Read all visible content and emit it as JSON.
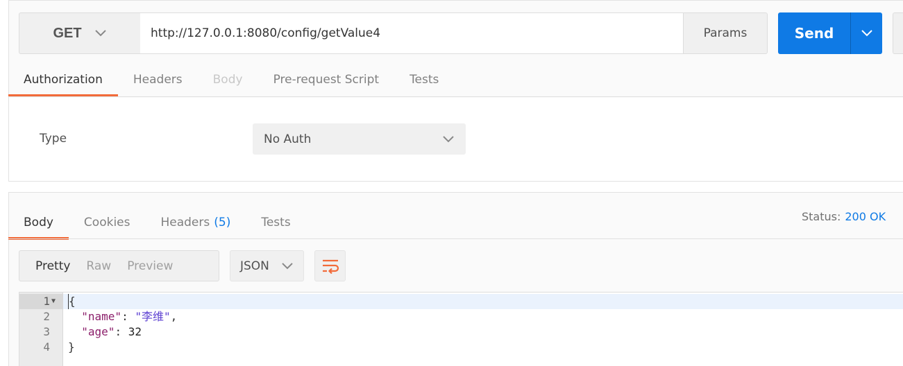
{
  "request": {
    "method": "GET",
    "url": "http://127.0.0.1:8080/config/getValue4",
    "params_label": "Params",
    "send_label": "Send",
    "tabs": [
      {
        "label": "Authorization",
        "state": "active"
      },
      {
        "label": "Headers",
        "state": "normal"
      },
      {
        "label": "Body",
        "state": "disabled"
      },
      {
        "label": "Pre-request Script",
        "state": "normal"
      },
      {
        "label": "Tests",
        "state": "normal"
      }
    ],
    "auth": {
      "type_label": "Type",
      "type_value": "No Auth"
    }
  },
  "response": {
    "tabs": [
      {
        "label": "Body",
        "state": "active"
      },
      {
        "label": "Cookies",
        "state": "normal"
      },
      {
        "label": "Headers",
        "count": "(5)",
        "state": "normal"
      },
      {
        "label": "Tests",
        "state": "normal"
      }
    ],
    "status_label": "Status:",
    "status_value": "200 OK",
    "views": [
      "Pretty",
      "Raw",
      "Preview"
    ],
    "active_view": "Pretty",
    "format": "JSON",
    "code": {
      "line_numbers": [
        "1",
        "2",
        "3",
        "4"
      ],
      "brace_open": "{",
      "key_name": "\"name\"",
      "value_name": "\"李维\"",
      "key_age": "\"age\"",
      "value_age": "32",
      "brace_close": "}"
    }
  },
  "colors": {
    "accent_blue": "#0f7ae5",
    "tab_active_orange": "#f26b3a"
  },
  "icons": [
    "chevron-down-icon",
    "wrap-lines-icon",
    "fold-arrow-icon"
  ]
}
